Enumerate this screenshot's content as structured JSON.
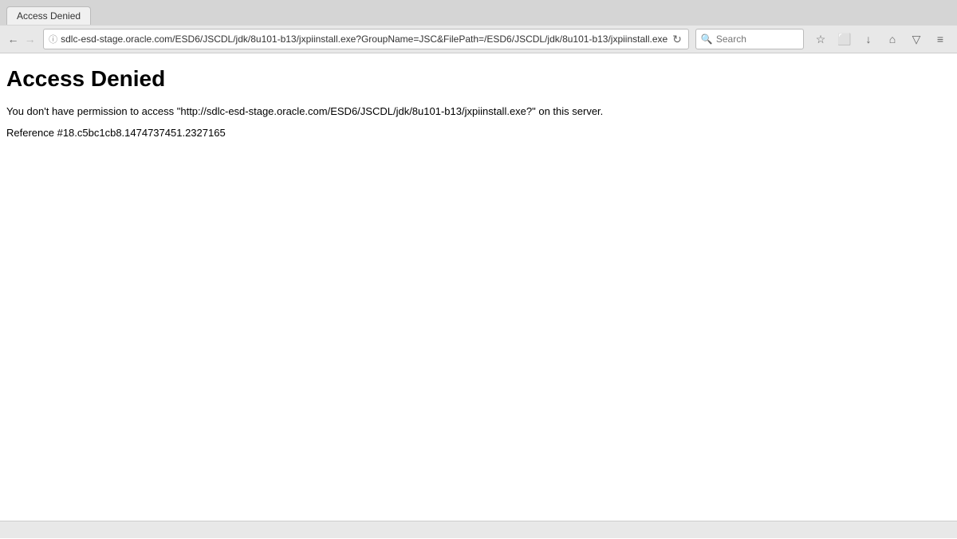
{
  "browser": {
    "tab_label": "Access Denied",
    "address": "sdlc-esd-stage.oracle.com/ESD6/JSCDL/jdk/8u101-b13/jxpiinstall.exe?GroupName=JSC&FilePath=/ESD6/JSCDL/jdk/8u101-b13/jxpiinstall.exe",
    "search_placeholder": "Search",
    "back_icon": "←",
    "forward_icon": "→",
    "reload_icon": "↻",
    "home_icon": "⌂",
    "bookmark_icon": "☆",
    "screenshot_icon": "⬜",
    "download_icon": "↓",
    "pocket_icon": "▽",
    "menu_icon": "≡",
    "lock_icon": "ⓘ"
  },
  "page": {
    "title": "Access Denied",
    "description": "You don't have permission to access \"http://sdlc-esd-stage.oracle.com/ESD6/JSCDL/jdk/8u101-b13/jxpiinstall.exe?\" on this server.",
    "reference": "Reference #18.c5bc1cb8.1474737451.2327165"
  }
}
